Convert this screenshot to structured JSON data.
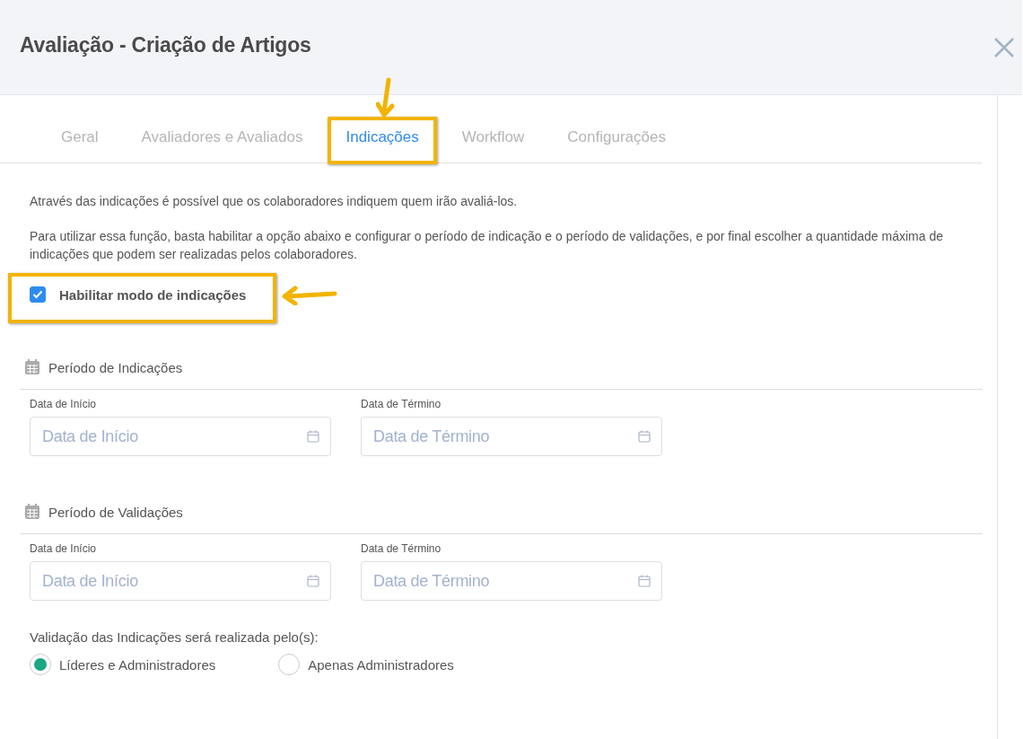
{
  "modal": {
    "title": "Avaliação - Criação de Artigos"
  },
  "tabs": [
    {
      "label": "Geral",
      "selected": false,
      "highlighted": false
    },
    {
      "label": "Avaliadores e Avaliados",
      "selected": false,
      "highlighted": false
    },
    {
      "label": "Indicações",
      "selected": true,
      "highlighted": true
    },
    {
      "label": "Workflow",
      "selected": false,
      "highlighted": false
    },
    {
      "label": "Configurações",
      "selected": false,
      "highlighted": false
    }
  ],
  "intro": [
    "Através das indicações é possível que os colaboradores indiquem quem irão avaliá-los.",
    "Para utilizar essa função, basta habilitar a opção abaixo e configurar o período de indicação e o período de validações, e por final escolher a quantidade máxima de indicações que podem ser realizadas pelos colaboradores."
  ],
  "enable_checkbox": {
    "label": "Habilitar modo de indicações",
    "checked": true,
    "highlighted": true
  },
  "periods": [
    {
      "title": "Período de Indicações",
      "fields": [
        {
          "label": "Data de Início",
          "placeholder": "Data de Início"
        },
        {
          "label": "Data de Término",
          "placeholder": "Data de Término"
        }
      ]
    },
    {
      "title": "Período de Validações",
      "fields": [
        {
          "label": "Data de Início",
          "placeholder": "Data de Início"
        },
        {
          "label": "Data de Término",
          "placeholder": "Data de Término"
        }
      ]
    }
  ],
  "validation": {
    "label": "Validação das Indicações será realizada pelo(s):",
    "options": [
      {
        "label": "Líderes e Administradores",
        "selected": true
      },
      {
        "label": "Apenas Administradores",
        "selected": false
      }
    ]
  }
}
